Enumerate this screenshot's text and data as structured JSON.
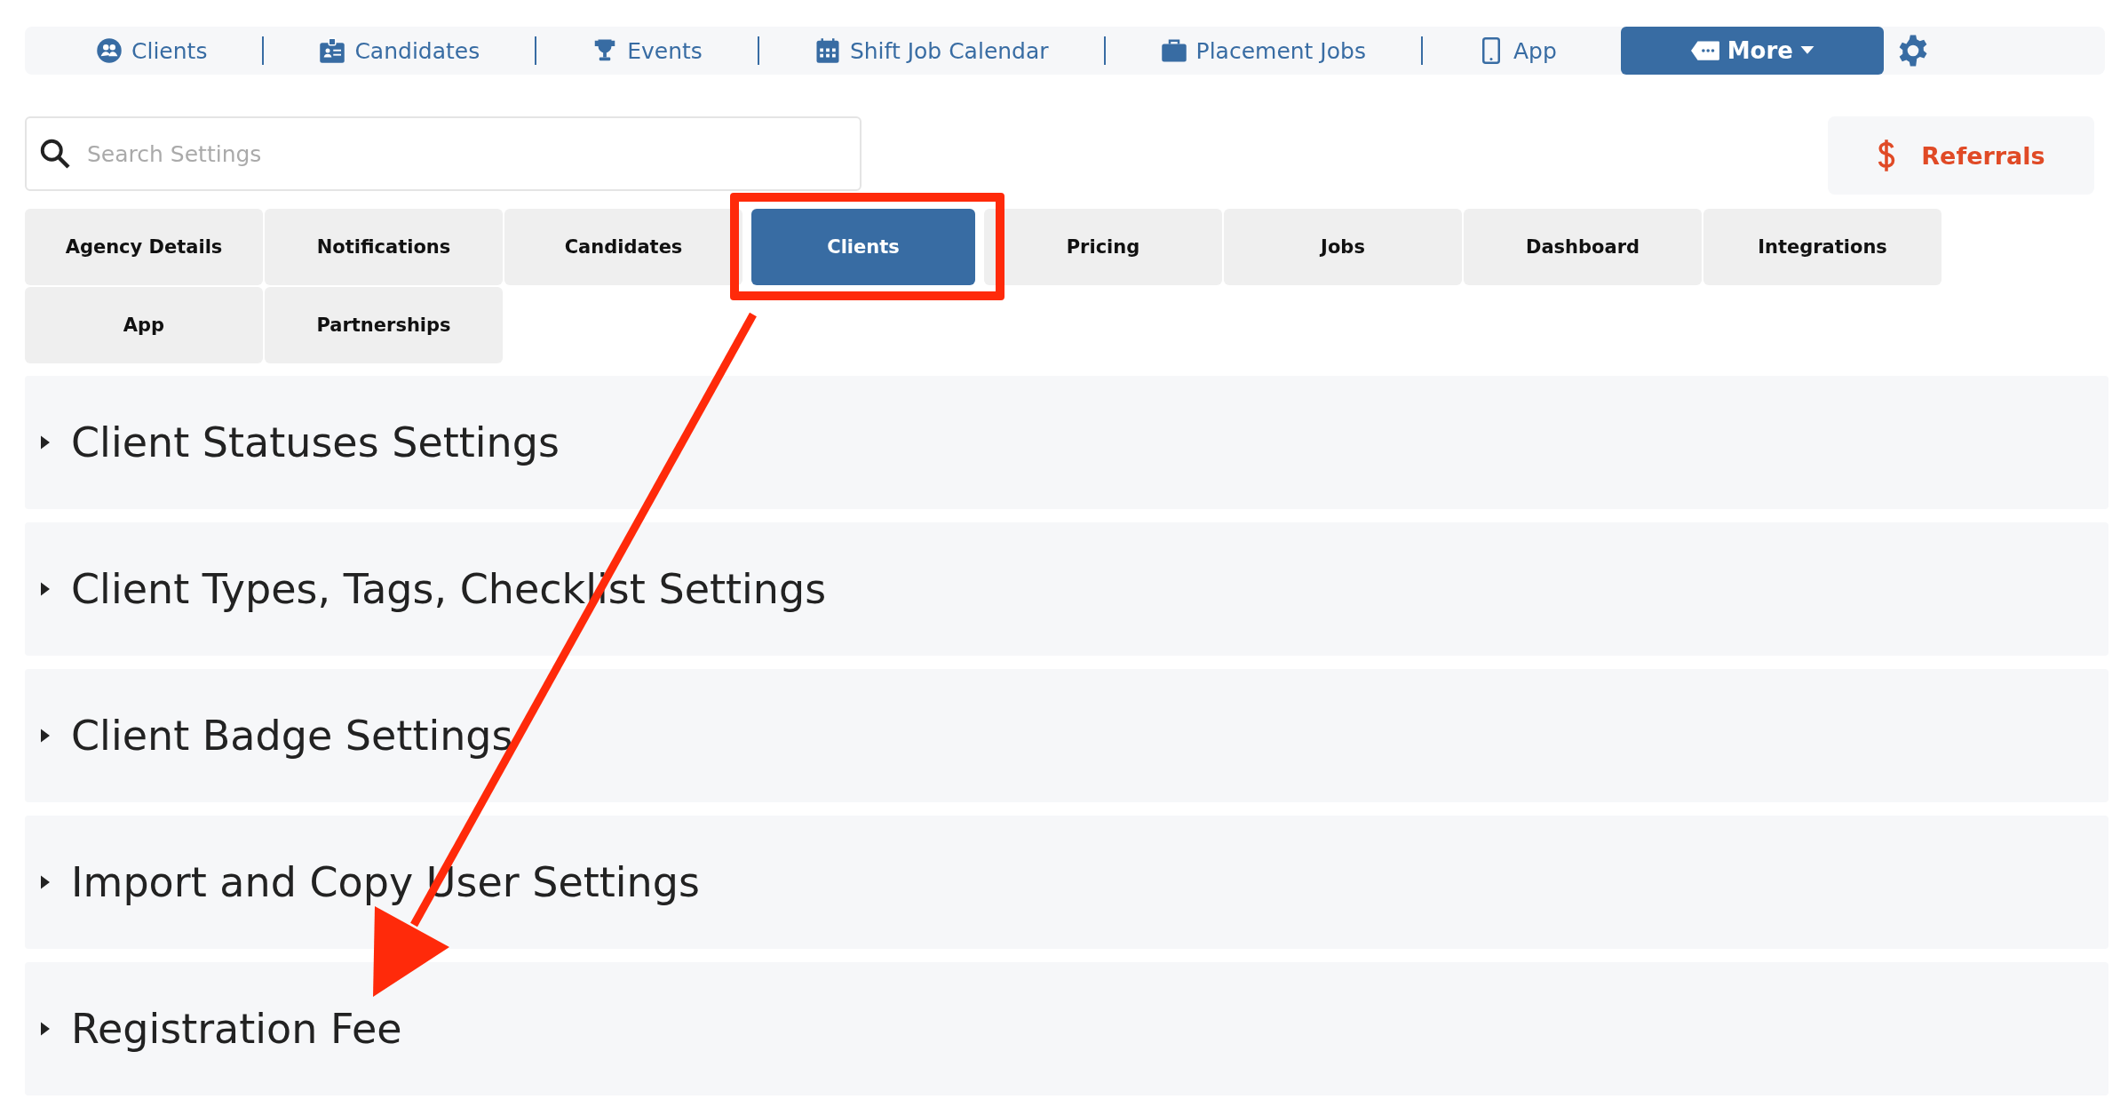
{
  "top_nav": {
    "items": [
      {
        "label": "Clients"
      },
      {
        "label": "Candidates"
      },
      {
        "label": "Events"
      },
      {
        "label": "Shift Job Calendar"
      },
      {
        "label": "Placement Jobs"
      },
      {
        "label": "App"
      }
    ],
    "more_button": {
      "label": "More"
    }
  },
  "search": {
    "placeholder": "Search Settings"
  },
  "referrals_button": {
    "label": "Referrals"
  },
  "tabs": [
    {
      "label": "Agency Details",
      "selected": false
    },
    {
      "label": "Notifications",
      "selected": false
    },
    {
      "label": "Candidates",
      "selected": false
    },
    {
      "label": "Clients",
      "selected": true
    },
    {
      "label": "Pricing",
      "selected": false
    },
    {
      "label": "Jobs",
      "selected": false
    },
    {
      "label": "Dashboard",
      "selected": false
    },
    {
      "label": "Integrations",
      "selected": false
    },
    {
      "label": "App",
      "selected": false
    },
    {
      "label": "Partnerships",
      "selected": false
    }
  ],
  "sections": [
    {
      "title": "Client Statuses Settings",
      "expanded": false
    },
    {
      "title": "Client Types, Tags, Checklist Settings",
      "expanded": false
    },
    {
      "title": "Client Badge Settings",
      "expanded": false
    },
    {
      "title": "Import and Copy User Settings",
      "expanded": false
    },
    {
      "title": "Registration Fee",
      "expanded": false
    }
  ]
}
